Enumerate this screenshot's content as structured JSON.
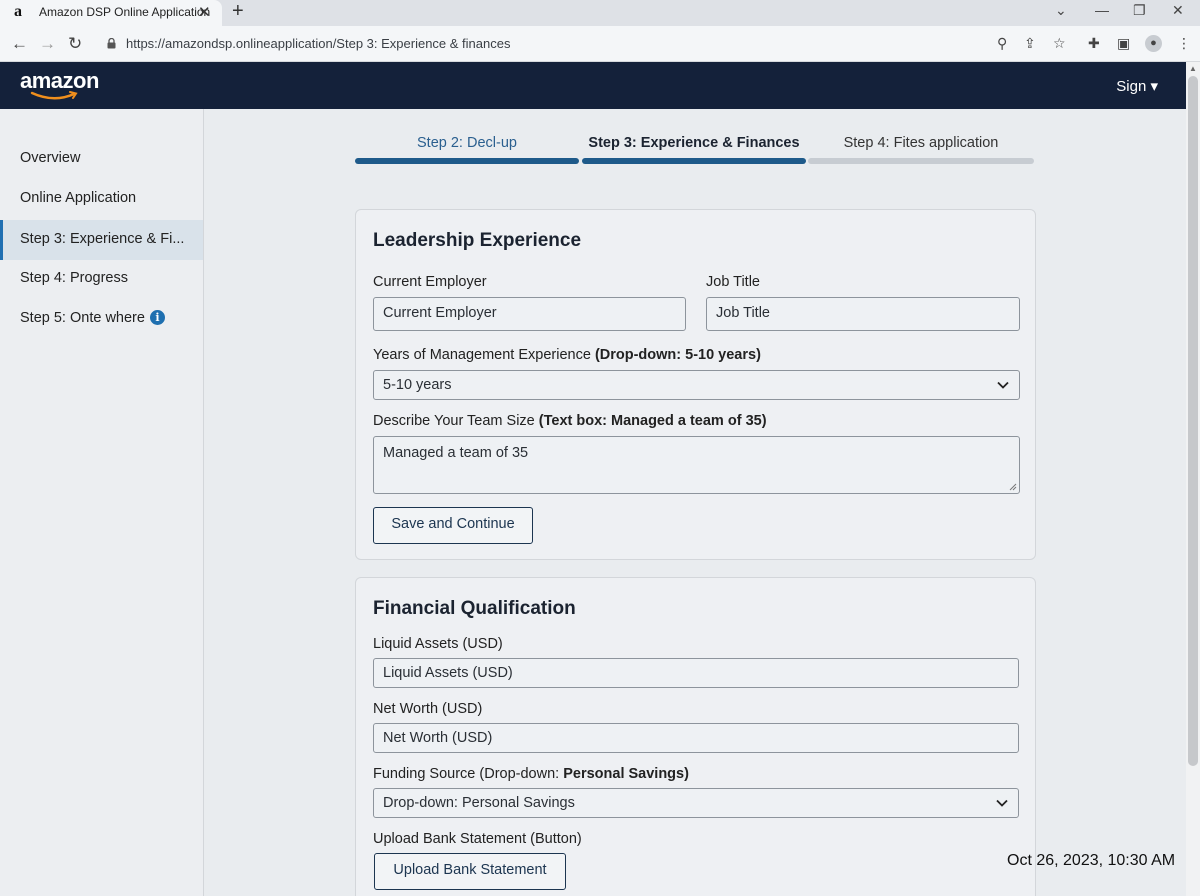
{
  "browser": {
    "tab_favicon": "a",
    "tab_title": "Amazon DSP Online Application",
    "tab_close": "✕",
    "new_tab": "+",
    "url": "https://amazondsp.onlineapplication/Step 3: Experience & finances",
    "icons": [
      "back-icon",
      "forward-icon",
      "reload-icon",
      "lock-icon",
      "zoom-icon",
      "share-icon",
      "star-icon",
      "extensions-icon",
      "sidepanel-icon",
      "profile-icon",
      "menu-icon"
    ]
  },
  "header": {
    "logo": "amazon",
    "sign": "Sign ▾"
  },
  "sidebar": {
    "items": [
      {
        "label": "Overview"
      },
      {
        "label": "Online Application"
      },
      {
        "label": "Step 3: Experience & Fi..."
      },
      {
        "label": "Step 4: Progress"
      },
      {
        "label": "Step 5: Onte where"
      }
    ],
    "info_glyph": "i"
  },
  "steps": [
    {
      "label": "Step 2: Decl-up"
    },
    {
      "label": "Step 3: Experience & Finances"
    },
    {
      "label": "Step 4: Fites application"
    }
  ],
  "leadership": {
    "title": "Leadership Experience",
    "employer_label": "Current Employer",
    "employer_value": "Current Employer",
    "job_label": "Job Title",
    "job_value": "Job Title",
    "years_label": "Years of Management Experience ",
    "years_label_bold": "(Drop-down: 5-10 years)",
    "years_value": "5-10 years",
    "team_label": "Describe Your Team Size ",
    "team_label_bold": "(Text box: Managed a team of 35)",
    "team_value": "Managed a team of 35",
    "save_button": "Save and Continue"
  },
  "financial": {
    "title": "Financial Qualification",
    "liquid_label": "Liquid Assets (USD)",
    "liquid_value": "Liquid Assets (USD)",
    "networth_label": "Net Worth (USD)",
    "networth_value": "Net Worth (USD)",
    "funding_label": "Funding Source (Drop-down: ",
    "funding_label_bold": "Personal Savings)",
    "funding_value": "Drop-down: Personal Savings",
    "upload_label": "Upload Bank Statement (Button)",
    "upload_button": "Upload Bank Statement"
  },
  "timestamp": "Oct 26, 2023, 10:30 AM",
  "colors": {
    "header_bg": "#14213a",
    "step_active": "#1e5a8a",
    "step_inactive": "#c7ccd2",
    "accent": "#1f6fb2"
  }
}
